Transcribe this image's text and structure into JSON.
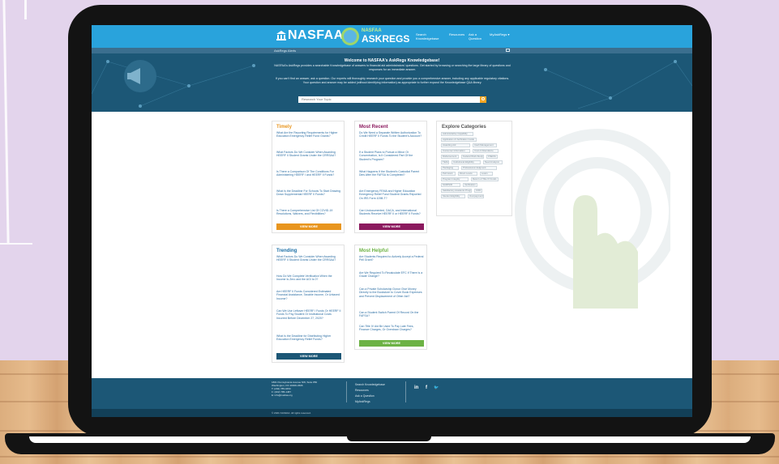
{
  "header": {
    "brand": "NASFAA",
    "product_small": "NASFAA",
    "product": "ASKREGS",
    "nav": [
      "Search Knowledgebase",
      "Resources",
      "Ask a Question",
      "MyAskRegs ▾"
    ]
  },
  "subbar": {
    "label": "AskRegs Alerts"
  },
  "hero": {
    "title": "Welcome to NASFAA's AskRegs Knowledgebase!",
    "p1": "NASFAA's AskRegs provides a searchable Knowledgebase of answers to financial aid administrators' questions. Get started by browsing or searching the large library of questions and responses for an immediate answer.",
    "p2": "If you can't find an answer, ask a question. Our experts will thoroughly research your question and provide you a comprehensive answer, including any applicable regulatory citations. Your question and answer may be added (without identifying information) as appropriate to further expand the Knowledgebase Q&A library.",
    "search_placeholder": "Research Your Topic"
  },
  "timely": {
    "title": "Timely",
    "color": "#e8951e",
    "items": [
      "What Are the Reporting Requirements for Higher Education Emergency Relief Fund Grants?",
      "What Factors Do We Consider When Awarding HEERF II Student Grants Under the CRRSAA?",
      "Is There a Comparison Of The Conditions For Administering HEERF I and HEERF II Funds?",
      "What Is the Deadline For Schools To Start Drawing Down Supplemental HEERF II Funds?",
      "Is There a Comprehensive List Of COVID-19 Resolutions, Waivers, and Flexibilities?"
    ],
    "more": "VIEW MORE"
  },
  "recent": {
    "title": "Most Recent",
    "color": "#8b1a5e",
    "items": [
      "Do We Need a Separate Written Authorization To Credit HEERF II Funds To the Student's Account?",
      "If a Student Plans to Pursue a Minor Or Concentration, Is It Considered Part Of the Student's Program?",
      "What Happens If the Student's Custodial Parent Dies After the FAFSA Is Completed?",
      "Are Emergency FEMA and Higher Education Emergency Relief Fund Student Grants Reported On IRS Form 1098-T?",
      "Can Undocumented, DACA, and International Students Receive HEERF II or HEERF II Funds?"
    ],
    "more": "VIEW MORE"
  },
  "trending": {
    "title": "Trending",
    "color": "#1c6fa6",
    "items": [
      "What Factors Do We Consider When Awarding HEERF II Student Grants Under the CRRSAA?",
      "How Do We Complete Verification When the Income Is Zero and the AGI Is 0?",
      "Are HEERF II Funds Considered Estimated Financial Assistance, Taxable Income, Or Untaxed Income?",
      "Can We Use Leftover HEERF I Funds Or HEERF II Funds To Pay Student Or Institutional Costs Incurred Before December 27, 2020?",
      "What Is the Deadline for Distributing Higher Education Emergency Relief Funds?"
    ],
    "more": "VIEW MORE"
  },
  "helpful": {
    "title": "Most Helpful",
    "color": "#6cb244",
    "items": [
      "Are Students Required to Actively Accept a Federal Pell Grant?",
      "Are We Required To Recalculate EFC If There Is a Grade Change?",
      "Can a Private Scholarship Donor Give Money Directly to the Bookstore to Cover Book Expenses and Prevent Displacement of Other Aid?",
      "Can a Student Switch Parent Of Record On the FAFSA?",
      "Can Title IV Aid Be Used To Pay Late Fees, Finance Charges, Or Overdraw Charges?"
    ],
    "more": "VIEW MORE"
  },
  "categories": {
    "title": "Explore Categories",
    "tags": [
      "Administrative Capability",
      "Application & Verification Guide",
      "Awarding Aid",
      "Cash Management",
      "Consumer Information",
      "Cost of Attendance",
      "Disbursement",
      "Federal Work-Study",
      "FSEOG",
      "Institutional Eligibility",
      "Need Analysis",
      "Packaging",
      "Pell Grant",
      "Professional Judgment",
      "Program Integrity",
      "Return of Title IV Funds",
      "Satisfactory Academic Progress",
      "SAR/ISIR",
      "Student Eligibility",
      "Verification",
      "COD",
      "Loans",
      "Direct Loans",
      "TEACH Grant",
      "Overpayments"
    ]
  },
  "footer": {
    "address": [
      "1801 Pennsylvania Avenue NW, Suite 850",
      "Washington, DC 20006-3606",
      "T: (202) 785-0453",
      "F: (202) 785-1487",
      "E: info@nasfaa.org"
    ],
    "links": [
      "Search Knowledgebase",
      "Resources",
      "Ask a Question",
      "MyAskRegs"
    ],
    "social": [
      "in",
      "f",
      "🐦"
    ],
    "copyright": "© 2021 NASFAA. All rights reserved."
  }
}
